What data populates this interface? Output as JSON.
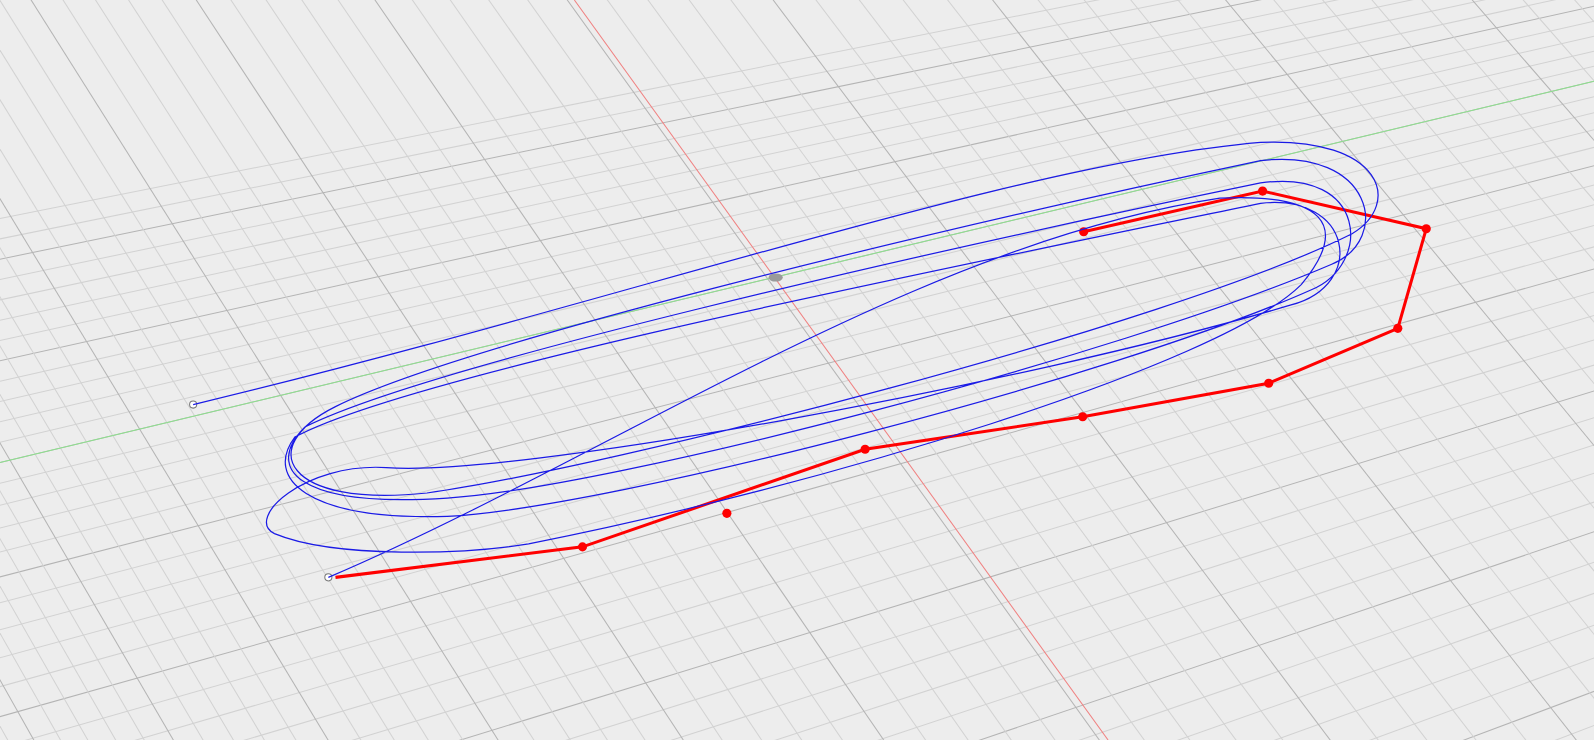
{
  "viewport": {
    "grid": true,
    "axes": true,
    "control_points_visible": true
  }
}
